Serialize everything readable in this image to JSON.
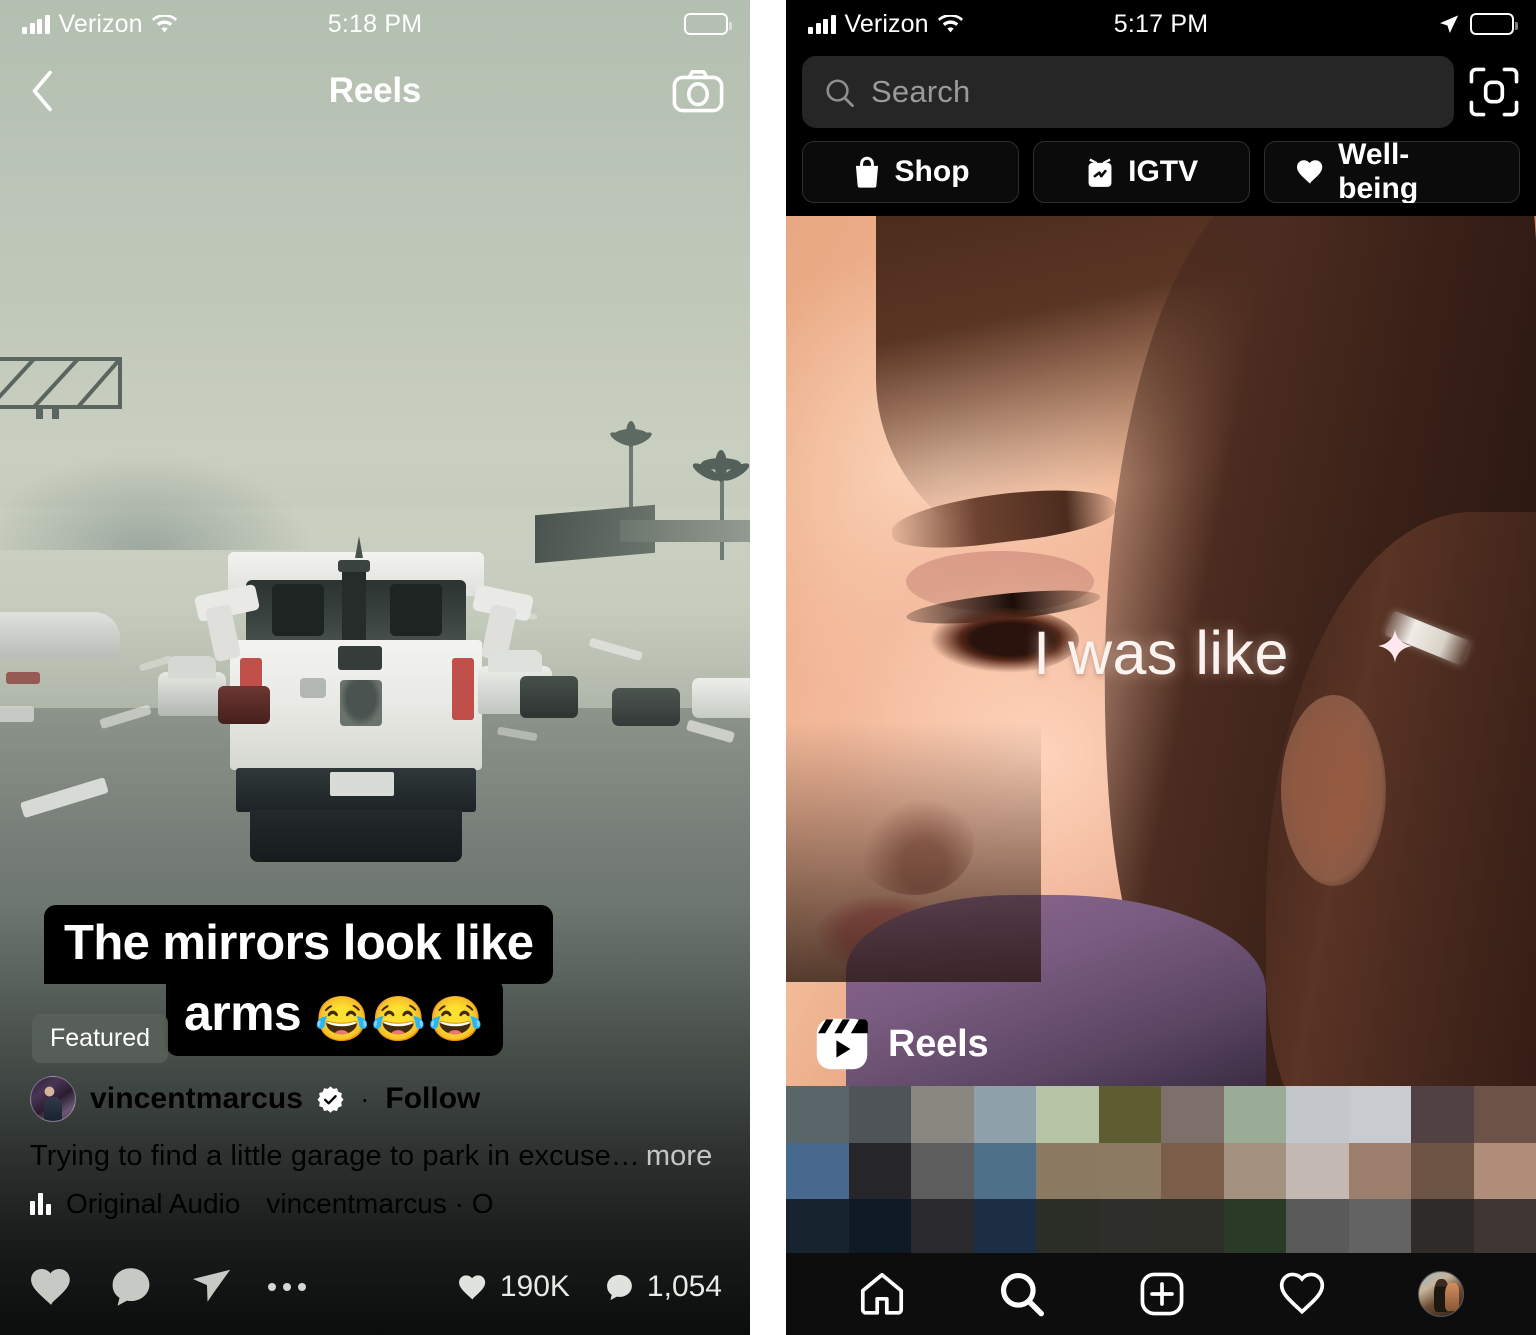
{
  "left_phone": {
    "status_bar": {
      "carrier": "Verizon",
      "time": "5:18 PM",
      "signal_icon": "signal-bars-icon",
      "wifi_icon": "wifi-icon",
      "battery_icon": "battery-icon"
    },
    "nav": {
      "back_icon": "chevron-left-icon",
      "title": "Reels",
      "camera_icon": "camera-icon"
    },
    "reel": {
      "sticker_line_1": "The mirrors look like",
      "sticker_line_2": "arms",
      "sticker_emoji": "😂😂😂",
      "featured_badge": "Featured",
      "author": "vincentmarcus",
      "verified_icon": "verified-badge-icon",
      "separator": "·",
      "follow_label": "Follow",
      "caption": "Trying to find a little garage to park in excuse…",
      "caption_more": "more",
      "audio_icon": "audio-waveform-icon",
      "audio_label": "Original Audio",
      "audio_author": "vincentmarcus · O"
    },
    "actions": {
      "like_icon": "heart-icon",
      "comment_icon": "comment-bubble-icon",
      "share_icon": "paper-plane-icon",
      "more_icon": "ellipsis-icon",
      "like_count_icon": "heart-filled-icon",
      "like_count": "190K",
      "comment_count_icon": "comment-filled-icon",
      "comment_count": "1,054"
    }
  },
  "right_phone": {
    "status_bar": {
      "carrier": "Verizon",
      "time": "5:17 PM",
      "signal_icon": "signal-bars-icon",
      "wifi_icon": "wifi-icon",
      "location_icon": "location-arrow-icon",
      "battery_icon": "battery-icon"
    },
    "search": {
      "icon": "search-icon",
      "placeholder": "Search",
      "value": "",
      "scan_icon": "scan-code-icon"
    },
    "chips": [
      {
        "label": "Shop",
        "icon": "shopping-bag-icon"
      },
      {
        "label": "IGTV",
        "icon": "igtv-icon"
      },
      {
        "label": "Well-being",
        "icon": "heart-filled-icon"
      }
    ],
    "featured_post": {
      "overlay_caption": "I was like",
      "reels_badge_label": "Reels",
      "reels_badge_icon": "reels-clapper-icon"
    },
    "bottom_nav": [
      {
        "name": "home",
        "icon": "home-icon",
        "active": false
      },
      {
        "name": "search",
        "icon": "search-icon",
        "active": true
      },
      {
        "name": "create",
        "icon": "plus-square-icon",
        "active": false
      },
      {
        "name": "activity",
        "icon": "heart-icon",
        "active": false
      },
      {
        "name": "profile",
        "icon": "profile-avatar",
        "active": false
      }
    ]
  },
  "annotation": {
    "arrow_icon": "green-arrow-pointing-to-search-tab",
    "arrow_color": "#14a085"
  },
  "mosaic_colors": [
    "#5a6569",
    "#4f5458",
    "#888880",
    "#8ea0a9",
    "#b5c4a4",
    "#5e5c31",
    "#7d6f69",
    "#9aab96",
    "#c3c6ca",
    "#c8cbcf",
    "#514144",
    "#6d5347",
    "#46698d",
    "#26262a",
    "#5d5d5d",
    "#4f7089",
    "#8b7a61",
    "#8d7a63",
    "#7b5e49",
    "#a59180",
    "#c3b8b2",
    "#9b7f6c",
    "#6e5444",
    "#b08d79",
    "#17232e",
    "#0f1a26",
    "#2a2a2e",
    "#1c2e44",
    "#2b2e26",
    "#2e2e2a",
    "#2d2e28",
    "#2b3a26",
    "#5a5a5a",
    "#636363",
    "#2f2b29",
    "#3e3733"
  ]
}
